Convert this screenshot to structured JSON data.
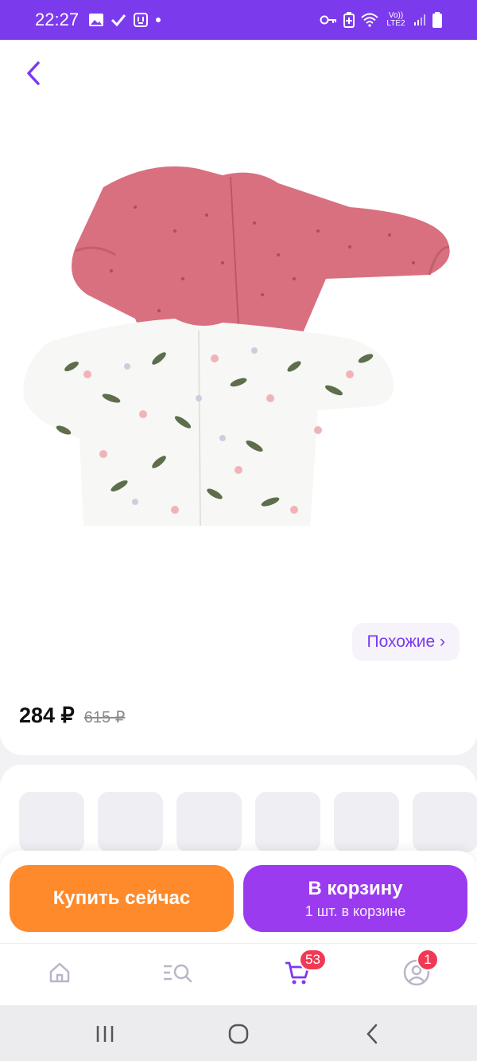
{
  "status_bar": {
    "time": "22:27",
    "left_icons": [
      "image-icon",
      "check-icon",
      "bag-icon",
      "dot-icon"
    ],
    "right_icons": [
      "key-icon",
      "battery-saver-icon",
      "wifi-icon",
      "volte-icon",
      "signal-icon",
      "battery-icon"
    ],
    "network_label": "Vo)) LTE2"
  },
  "product": {
    "image_description_icon": "baby-jackets-image"
  },
  "similar": {
    "label": "Похожие ›"
  },
  "price": {
    "current": "284 ₽",
    "old": "615 ₽"
  },
  "actions": {
    "buy_now": "Купить сейчас",
    "to_cart_title": "В корзину",
    "to_cart_subtitle": "1 шт. в корзине"
  },
  "tabbar": {
    "cart_badge": "53",
    "profile_badge": "1"
  },
  "colors": {
    "accent": "#7c3aed",
    "buy_now": "#ff8a2b",
    "to_cart": "#9b3bf0",
    "badge": "#f03a55"
  }
}
